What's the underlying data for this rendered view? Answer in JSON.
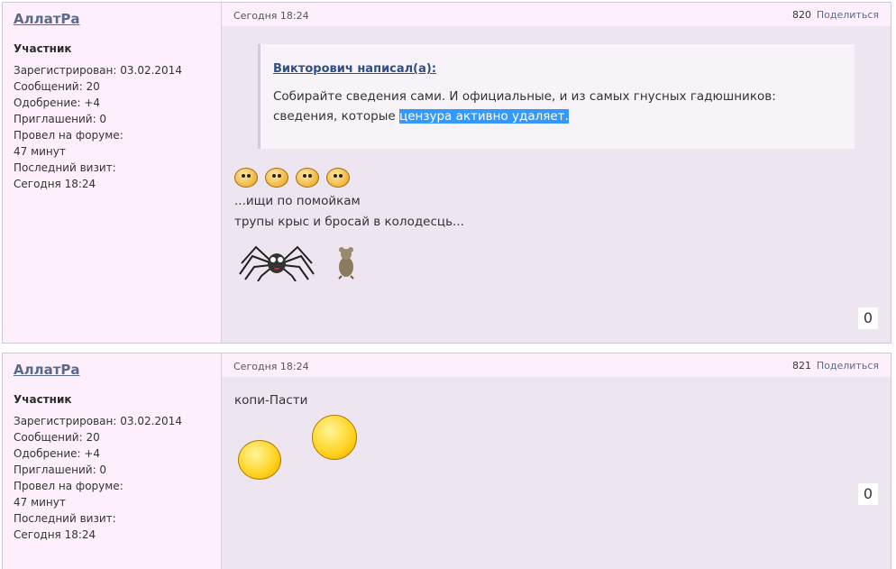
{
  "posts": [
    {
      "author": "АллатРа",
      "rank": "Участник",
      "registered": "Зарегистрирован: 03.02.2014",
      "messages": "Сообщений: 20",
      "approval": "Одобрение: +4",
      "invites": "Приглашений: 0",
      "forum_time_label": "Провел на форуме:",
      "forum_time": "47 минут",
      "last_visit_label": "Последний визит:",
      "last_visit": "Сегодня 18:24",
      "date": "Сегодня 18:24",
      "number": "820",
      "share": "Поделиться",
      "quote": {
        "author": "Викторович написал(а):",
        "text_plain": "Собирайте сведения сами. И официальные, и из  самых гнусных гадюшников: сведения, которые ",
        "text_highlight": "цензура активно удаляет."
      },
      "lines": [
        "...ищи по помойкам",
        "трупы крыс и бросай в колодесць..."
      ],
      "rating": "0"
    },
    {
      "author": "АллатРа",
      "rank": "Участник",
      "registered": "Зарегистрирован: 03.02.2014",
      "messages": "Сообщений: 20",
      "approval": "Одобрение: +4",
      "invites": "Приглашений: 0",
      "forum_time_label": "Провел на форуме:",
      "forum_time": "47 минут",
      "last_visit_label": "Последний визит:",
      "last_visit": "Сегодня 18:24",
      "date": "Сегодня 18:24",
      "number": "821",
      "share": "Поделиться",
      "text": "копи-Пасти",
      "rating": "0"
    }
  ]
}
